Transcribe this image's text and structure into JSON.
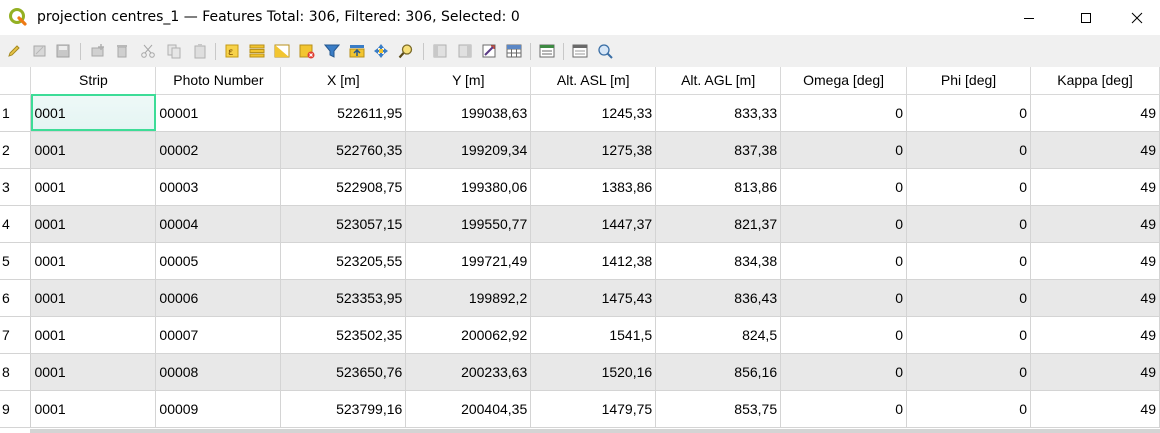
{
  "window": {
    "title": "projection centres_1 — Features Total: 306, Filtered: 306, Selected: 0"
  },
  "toolbar": {
    "icons": [
      "toggle-editing-icon",
      "toggle-multi-edit-icon",
      "save-edits-icon",
      "add-feature-icon",
      "delete-feature-icon",
      "cut-icon",
      "copy-icon",
      "paste-icon",
      "select-by-expression-icon",
      "select-all-icon",
      "invert-selection-icon",
      "deselect-all-icon",
      "filter-select-icon",
      "move-selection-to-top-icon",
      "pan-to-selected-icon",
      "zoom-to-selected-icon",
      "new-field-icon",
      "delete-field-icon",
      "open-field-calculator-icon",
      "conditional-formatting-icon",
      "dock-table-icon",
      "actions-icon"
    ]
  },
  "table": {
    "columns": [
      "Strip",
      "Photo Number",
      "X [m]",
      "Y [m]",
      "Alt. ASL [m]",
      "Alt. AGL [m]",
      "Omega [deg]",
      "Phi [deg]",
      "Kappa [deg]"
    ],
    "rows": [
      {
        "id": "1",
        "cells": [
          "0001",
          "00001",
          "522611,95",
          "199038,63",
          "1245,33",
          "833,33",
          "0",
          "0",
          "49"
        ]
      },
      {
        "id": "2",
        "cells": [
          "0001",
          "00002",
          "522760,35",
          "199209,34",
          "1275,38",
          "837,38",
          "0",
          "0",
          "49"
        ]
      },
      {
        "id": "3",
        "cells": [
          "0001",
          "00003",
          "522908,75",
          "199380,06",
          "1383,86",
          "813,86",
          "0",
          "0",
          "49"
        ]
      },
      {
        "id": "4",
        "cells": [
          "0001",
          "00004",
          "523057,15",
          "199550,77",
          "1447,37",
          "821,37",
          "0",
          "0",
          "49"
        ]
      },
      {
        "id": "5",
        "cells": [
          "0001",
          "00005",
          "523205,55",
          "199721,49",
          "1412,38",
          "834,38",
          "0",
          "0",
          "49"
        ]
      },
      {
        "id": "6",
        "cells": [
          "0001",
          "00006",
          "523353,95",
          "199892,2",
          "1475,43",
          "836,43",
          "0",
          "0",
          "49"
        ]
      },
      {
        "id": "7",
        "cells": [
          "0001",
          "00007",
          "523502,35",
          "200062,92",
          "1541,5",
          "824,5",
          "0",
          "0",
          "49"
        ]
      },
      {
        "id": "8",
        "cells": [
          "0001",
          "00008",
          "523650,76",
          "200233,63",
          "1520,16",
          "856,16",
          "0",
          "0",
          "49"
        ]
      },
      {
        "id": "9",
        "cells": [
          "0001",
          "00009",
          "523799,16",
          "200404,35",
          "1479,75",
          "853,75",
          "0",
          "0",
          "49"
        ]
      }
    ]
  },
  "colors": {
    "alt_row": "#e8e8e8",
    "focus_outline": "#3ddc97",
    "qgis_green": "#93b023"
  }
}
